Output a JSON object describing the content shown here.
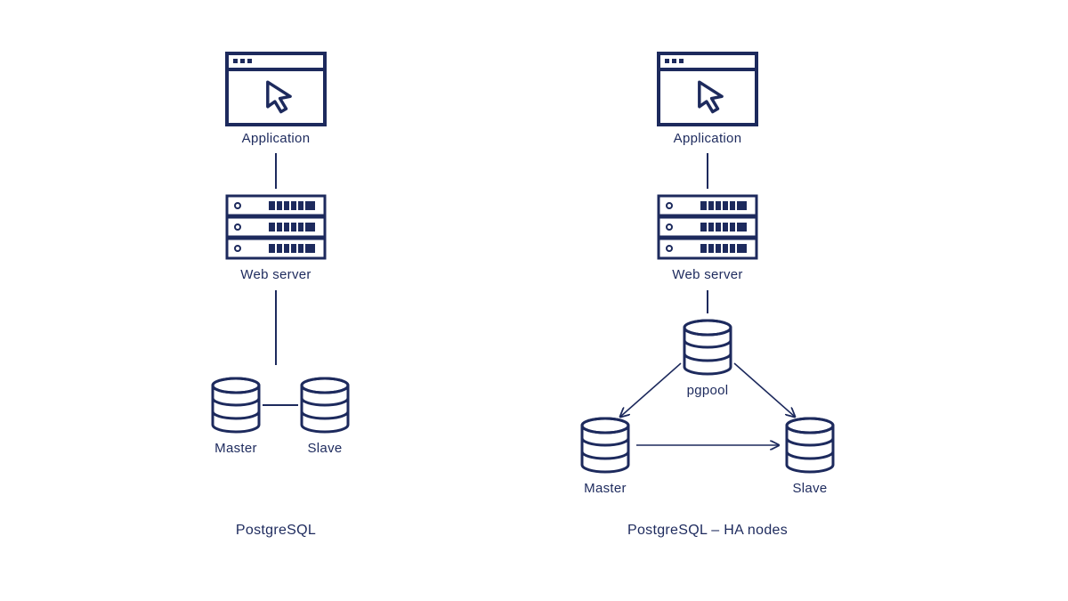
{
  "colors": {
    "primary": "#1d2a5d",
    "bg": "#ffffff"
  },
  "icons": {
    "application": "browser-cursor-icon",
    "webserver": "server-rack-icon",
    "database": "database-cylinder-icon"
  },
  "left": {
    "application_label": "Application",
    "webserver_label": "Web server",
    "db_master_label": "Master",
    "db_slave_label": "Slave",
    "title": "PostgreSQL"
  },
  "right": {
    "application_label": "Application",
    "webserver_label": "Web server",
    "pgpool_label": "pgpool",
    "db_master_label": "Master",
    "db_slave_label": "Slave",
    "title": "PostgreSQL – HA nodes"
  }
}
